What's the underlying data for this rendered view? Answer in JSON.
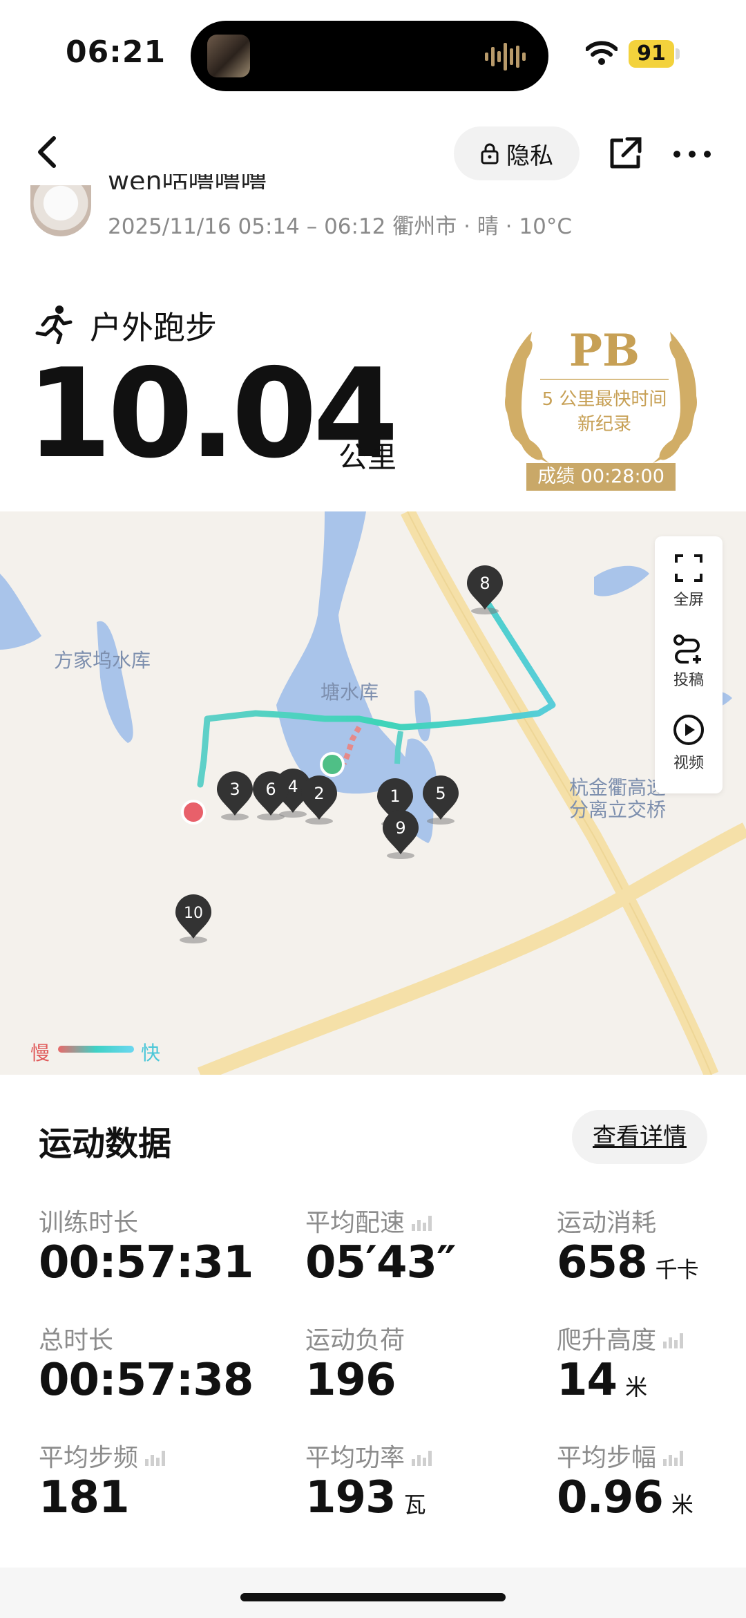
{
  "status_bar": {
    "time": "06:21",
    "battery": "91"
  },
  "header": {
    "privacy_label": "隐私"
  },
  "user": {
    "name": "wen咕噜噜噜",
    "meta": "2025/11/16 05:14 – 06:12 衢州市 · 晴 · 10°C"
  },
  "activity": {
    "type": "户外跑步",
    "distance": "10.04",
    "distance_unit": "公里"
  },
  "badge": {
    "title": "PB",
    "line1": "5 公里最快时间",
    "line2": "新纪录",
    "result": "成绩 00:28:00"
  },
  "map": {
    "labels": [
      "方家坞水库",
      "塘水库",
      "杭金衢高速",
      "分离立交桥"
    ],
    "tools": [
      "全屏",
      "投稿",
      "视频"
    ],
    "legend_slow": "慢",
    "legend_fast": "快",
    "markers": [
      "1",
      "2",
      "3",
      "4",
      "5",
      "6",
      "8",
      "9",
      "10"
    ]
  },
  "stats": {
    "title": "运动数据",
    "detail_label": "查看详情",
    "items": [
      {
        "label": "训练时长",
        "value": "00:57:31",
        "unit": ""
      },
      {
        "label": "平均配速",
        "value": "05′43″",
        "unit": ""
      },
      {
        "label": "运动消耗",
        "value": "658",
        "unit": "千卡"
      },
      {
        "label": "总时长",
        "value": "00:57:38",
        "unit": ""
      },
      {
        "label": "运动负荷",
        "value": "196",
        "unit": ""
      },
      {
        "label": "爬升高度",
        "value": "14",
        "unit": "米"
      },
      {
        "label": "平均步频",
        "value": "181",
        "unit": ""
      },
      {
        "label": "平均功率",
        "value": "193",
        "unit": "瓦"
      },
      {
        "label": "平均步幅",
        "value": "0.96",
        "unit": "米"
      }
    ]
  }
}
